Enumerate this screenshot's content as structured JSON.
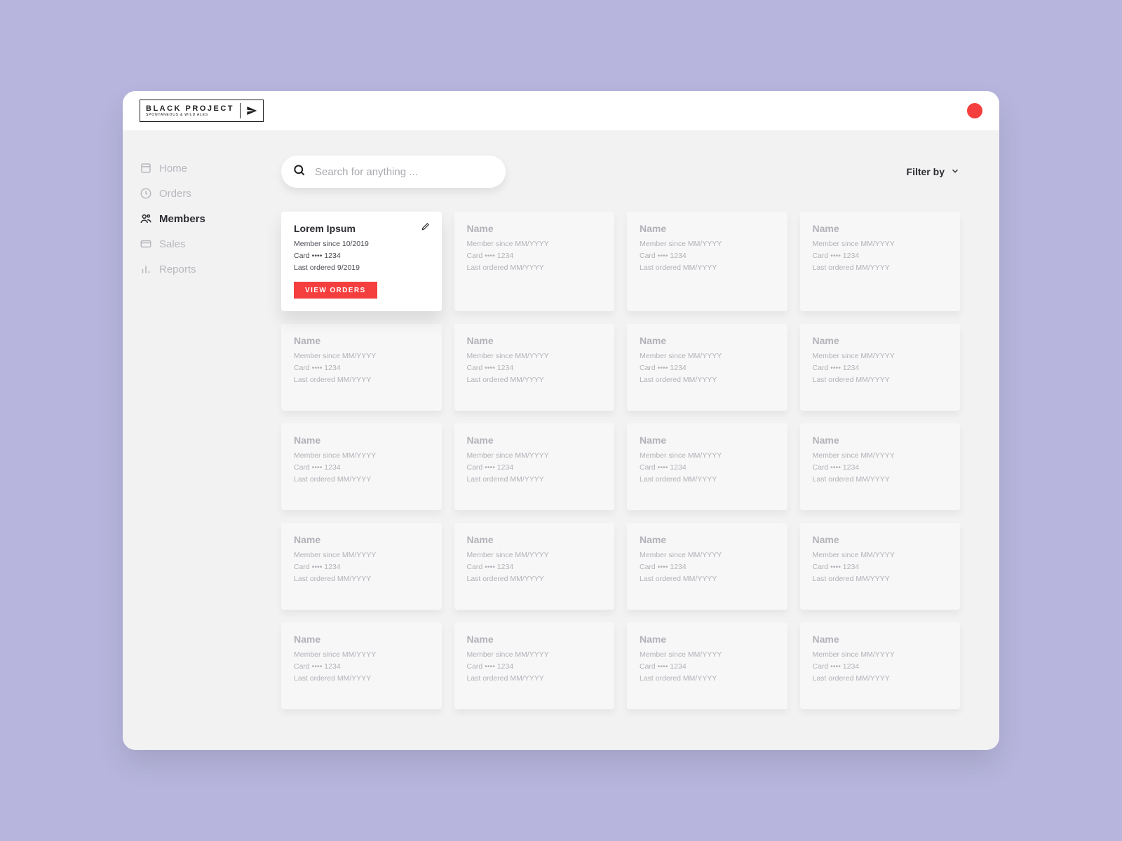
{
  "colors": {
    "accent": "#F53E3E",
    "bg": "#B7B5DD"
  },
  "header": {
    "logo_text": "BLACK PROJECT",
    "logo_tagline": "SPONTANEOUS & WILD ALES"
  },
  "sidebar": {
    "items": [
      {
        "label": "Home"
      },
      {
        "label": "Orders"
      },
      {
        "label": "Members"
      },
      {
        "label": "Sales"
      },
      {
        "label": "Reports"
      }
    ],
    "active_index": 2
  },
  "toolbar": {
    "search_placeholder": "Search for anything ...",
    "filter_label": "Filter by"
  },
  "member_detail_labels": {
    "member_since_prefix": "Member since",
    "card_prefix": "Card",
    "last_ordered_prefix": "Last ordered"
  },
  "members": [
    {
      "name": "Lorem Ipsum",
      "member_since": "10/2019",
      "card": "•••• 1234",
      "last_ordered": "9/2019",
      "active": true,
      "view_orders_label": "VIEW ORDERS"
    },
    {
      "name": "Name",
      "member_since": "MM/YYYY",
      "card": "•••• 1234",
      "last_ordered": "MM/YYYY"
    },
    {
      "name": "Name",
      "member_since": "MM/YYYY",
      "card": "•••• 1234",
      "last_ordered": "MM/YYYY"
    },
    {
      "name": "Name",
      "member_since": "MM/YYYY",
      "card": "•••• 1234",
      "last_ordered": "MM/YYYY"
    },
    {
      "name": "Name",
      "member_since": "MM/YYYY",
      "card": "•••• 1234",
      "last_ordered": "MM/YYYY"
    },
    {
      "name": "Name",
      "member_since": "MM/YYYY",
      "card": "•••• 1234",
      "last_ordered": "MM/YYYY"
    },
    {
      "name": "Name",
      "member_since": "MM/YYYY",
      "card": "•••• 1234",
      "last_ordered": "MM/YYYY"
    },
    {
      "name": "Name",
      "member_since": "MM/YYYY",
      "card": "•••• 1234",
      "last_ordered": "MM/YYYY"
    },
    {
      "name": "Name",
      "member_since": "MM/YYYY",
      "card": "•••• 1234",
      "last_ordered": "MM/YYYY"
    },
    {
      "name": "Name",
      "member_since": "MM/YYYY",
      "card": "•••• 1234",
      "last_ordered": "MM/YYYY"
    },
    {
      "name": "Name",
      "member_since": "MM/YYYY",
      "card": "•••• 1234",
      "last_ordered": "MM/YYYY"
    },
    {
      "name": "Name",
      "member_since": "MM/YYYY",
      "card": "•••• 1234",
      "last_ordered": "MM/YYYY"
    },
    {
      "name": "Name",
      "member_since": "MM/YYYY",
      "card": "•••• 1234",
      "last_ordered": "MM/YYYY"
    },
    {
      "name": "Name",
      "member_since": "MM/YYYY",
      "card": "•••• 1234",
      "last_ordered": "MM/YYYY"
    },
    {
      "name": "Name",
      "member_since": "MM/YYYY",
      "card": "•••• 1234",
      "last_ordered": "MM/YYYY"
    },
    {
      "name": "Name",
      "member_since": "MM/YYYY",
      "card": "•••• 1234",
      "last_ordered": "MM/YYYY"
    },
    {
      "name": "Name",
      "member_since": "MM/YYYY",
      "card": "•••• 1234",
      "last_ordered": "MM/YYYY"
    },
    {
      "name": "Name",
      "member_since": "MM/YYYY",
      "card": "•••• 1234",
      "last_ordered": "MM/YYYY"
    },
    {
      "name": "Name",
      "member_since": "MM/YYYY",
      "card": "•••• 1234",
      "last_ordered": "MM/YYYY"
    },
    {
      "name": "Name",
      "member_since": "MM/YYYY",
      "card": "•••• 1234",
      "last_ordered": "MM/YYYY"
    }
  ]
}
